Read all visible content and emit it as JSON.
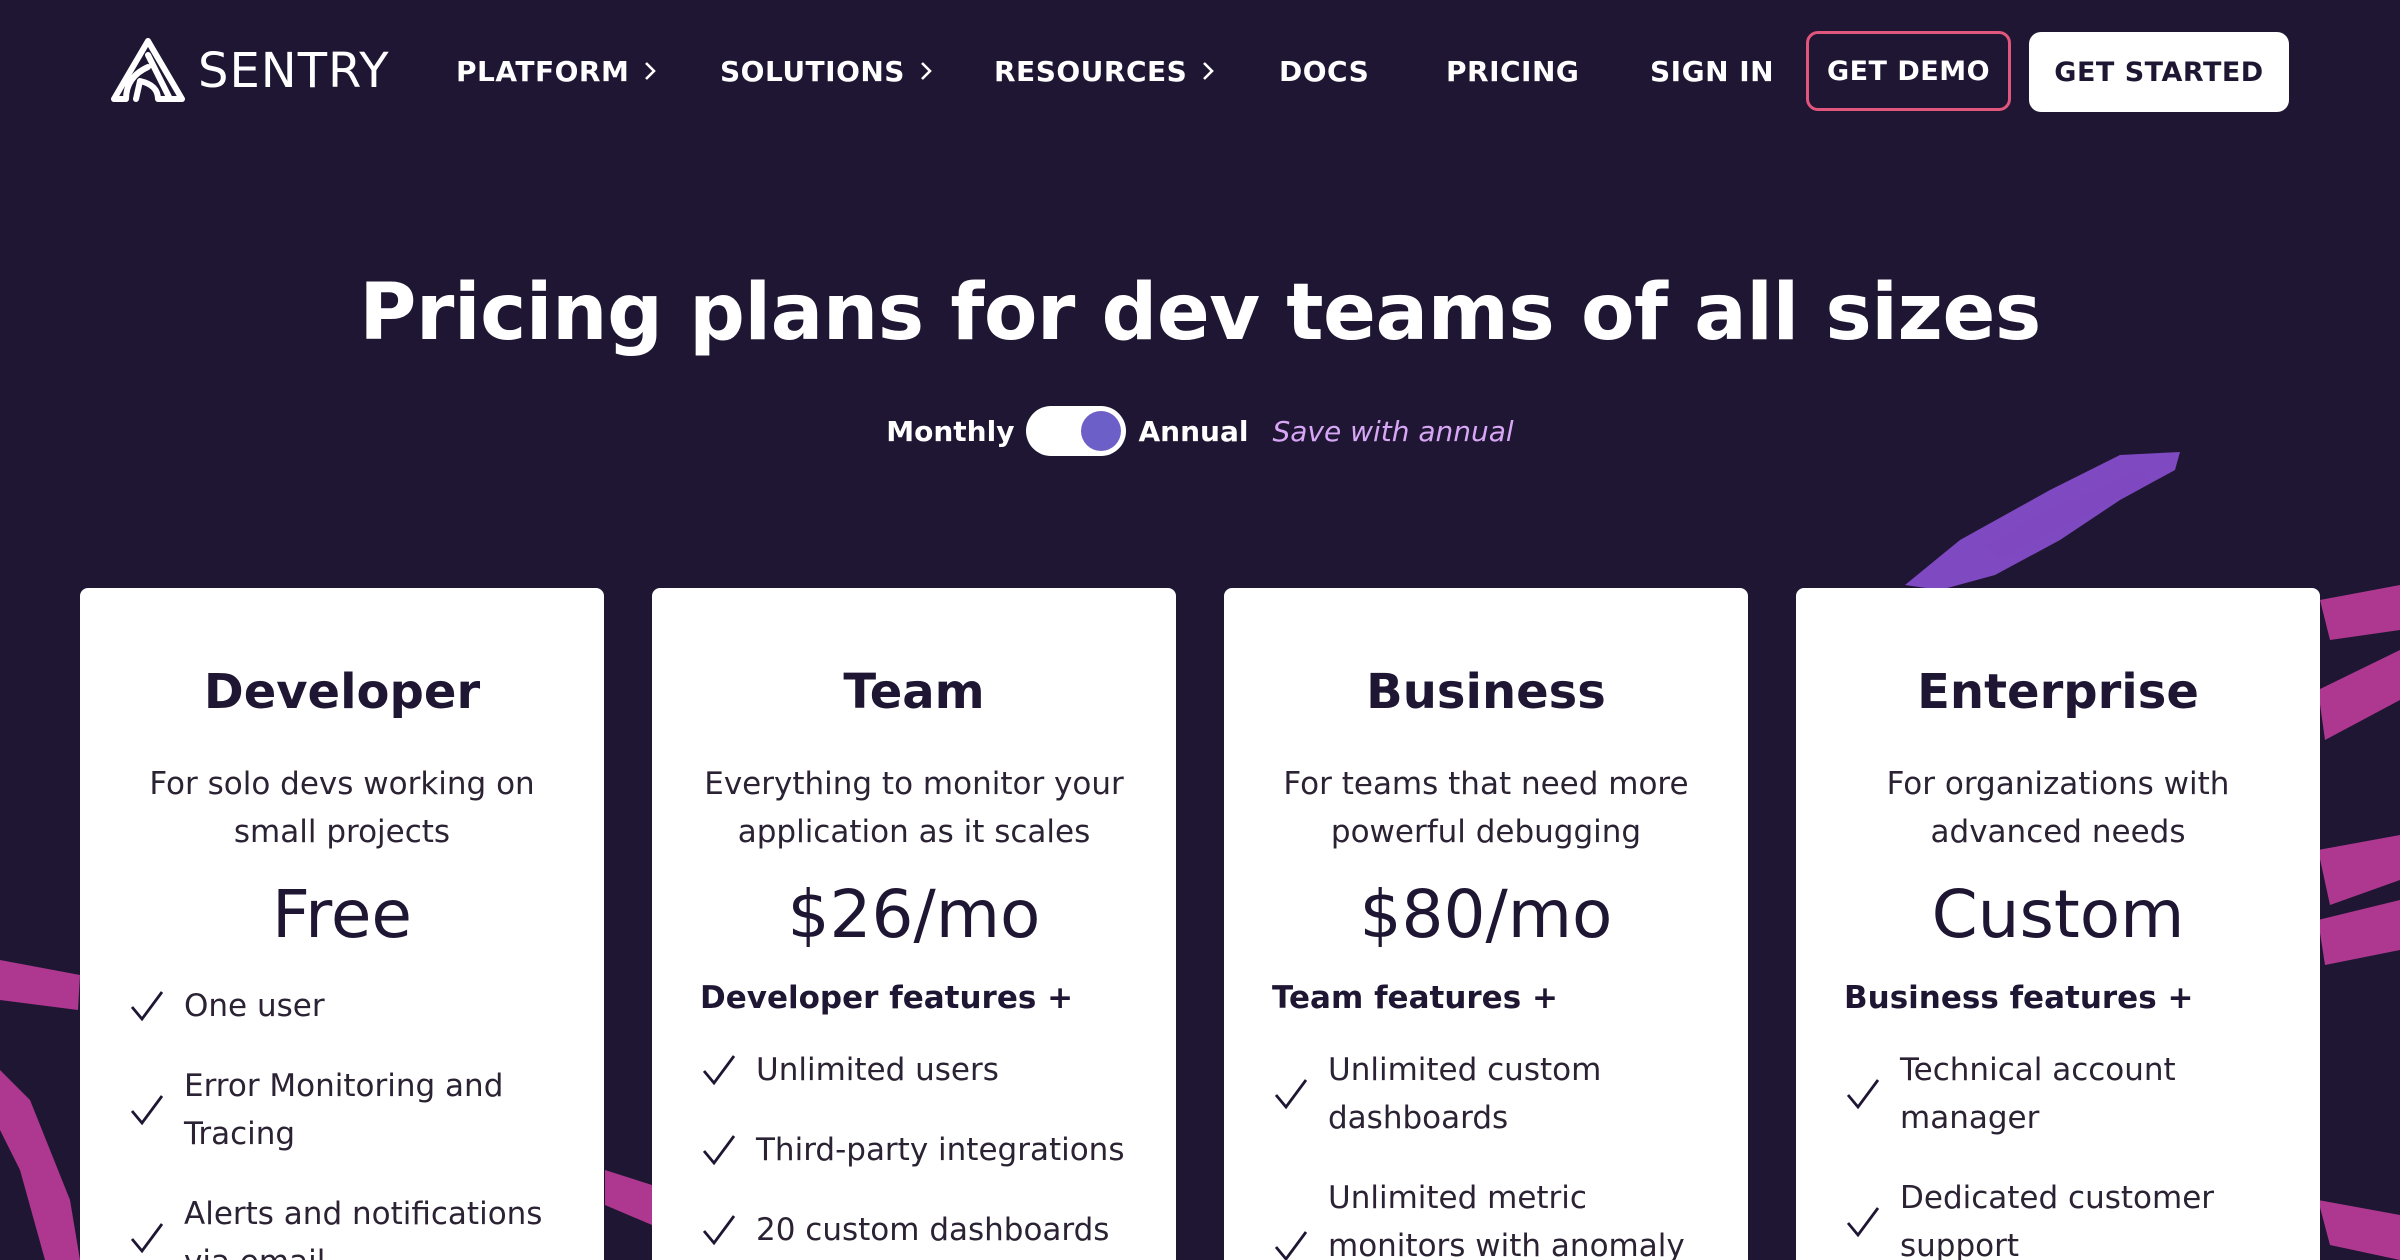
{
  "brand": {
    "name": "SENTRY"
  },
  "nav": {
    "items": [
      {
        "label": "PLATFORM",
        "has_submenu": true
      },
      {
        "label": "SOLUTIONS",
        "has_submenu": true
      },
      {
        "label": "RESOURCES",
        "has_submenu": true
      },
      {
        "label": "DOCS",
        "has_submenu": false
      },
      {
        "label": "PRICING",
        "has_submenu": false
      },
      {
        "label": "SIGN IN",
        "has_submenu": false
      }
    ],
    "get_demo": "GET DEMO",
    "get_started": "GET STARTED"
  },
  "hero": {
    "title": "Pricing plans for dev teams of all sizes",
    "billing": {
      "monthly": "Monthly",
      "annual": "Annual",
      "selected": "Annual",
      "save_note": "Save with annual"
    }
  },
  "plans": [
    {
      "name": "Developer",
      "description": "For solo devs working on small projects",
      "price": "Free",
      "includes": "",
      "features": [
        "One user",
        "Error Monitoring and Tracing",
        "Alerts and notifications via email"
      ]
    },
    {
      "name": "Team",
      "description": "Everything to monitor your application as it scales",
      "price": "$26/mo",
      "includes": "Developer features +",
      "features": [
        "Unlimited users",
        "Third-party integrations",
        "20 custom dashboards"
      ]
    },
    {
      "name": "Business",
      "description": "For teams that need more powerful debugging",
      "price": "$80/mo",
      "includes": "Team features +",
      "features": [
        "Unlimited custom dashboards",
        "Unlimited metric monitors with anomaly detection"
      ]
    },
    {
      "name": "Enterprise",
      "description": "For organizations with advanced needs",
      "price": "Custom",
      "includes": "Business features +",
      "features": [
        "Technical account manager",
        "Dedicated customer support"
      ]
    }
  ],
  "colors": {
    "background": "#1f1633",
    "demo_border": "#e1567c",
    "toggle_knob": "#6c5fc7",
    "save_note": "#d7a6f5",
    "stroke_purple": "#8a4fd1",
    "stroke_pink": "#c83ea0"
  },
  "icons": {
    "chevron": "chevron-right-icon",
    "check": "check-icon",
    "logo": "sentry-logo-icon"
  }
}
